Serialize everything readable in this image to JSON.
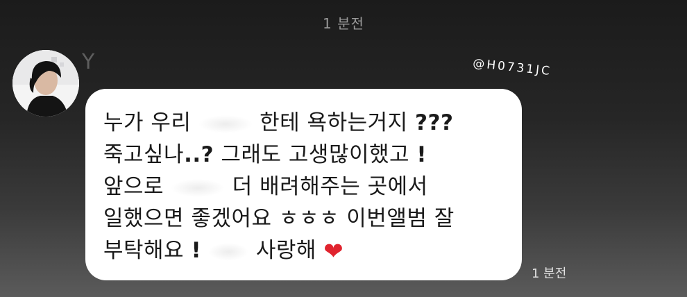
{
  "header": {
    "time_label": "1 분전"
  },
  "sender": {
    "initial": "Y"
  },
  "watermark": {
    "text": "@H0731JC"
  },
  "message": {
    "line1": {
      "a": "누가 우리",
      "b": "한테 욕하는거지",
      "c": "???"
    },
    "line2": {
      "a": "죽고싶나",
      "b": "..?",
      "c": "그래도 고생많이했고",
      "d": "!"
    },
    "line3": {
      "a": "앞으로",
      "b": "더 배려해주는 곳에서"
    },
    "line4": {
      "a": "일했으면 좋겠어요 ㅎㅎㅎ 이번앨범 잘"
    },
    "line5": {
      "a": "부탁해요",
      "b": "!",
      "c": "사랑해",
      "heart": "❤"
    },
    "time_label": "1 분전"
  }
}
